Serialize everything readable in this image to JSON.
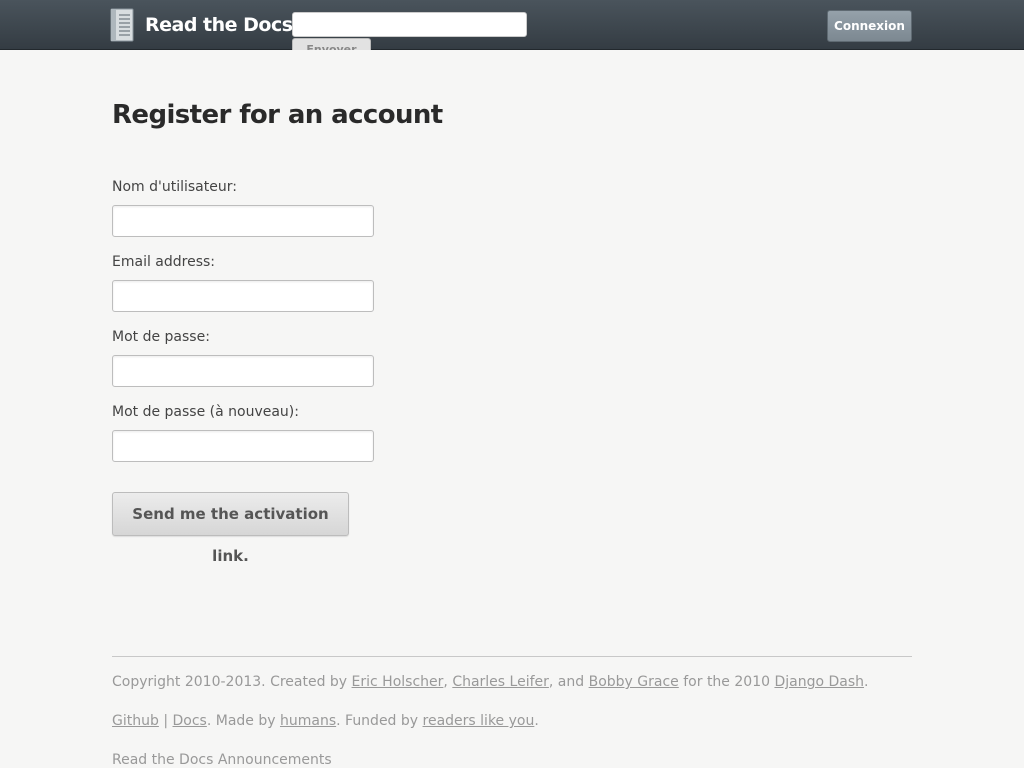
{
  "header": {
    "brand": "Read the Docs",
    "search_placeholder": "",
    "search_button": "Envoyer",
    "login_button": "Connexion"
  },
  "main": {
    "title": "Register for an account",
    "fields": [
      {
        "label": "Nom d'utilisateur:",
        "value": ""
      },
      {
        "label": "Email address:",
        "value": ""
      },
      {
        "label": "Mot de passe:",
        "value": ""
      },
      {
        "label": "Mot de passe (à nouveau):",
        "value": ""
      }
    ],
    "submit_button": "Send me the activation link."
  },
  "footer": {
    "copyright": {
      "prefix": "Copyright 2010-2013. Created by ",
      "author1": "Eric Holscher",
      "sep1": ", ",
      "author2": "Charles Leifer",
      "sep2": ", and ",
      "author3": "Bobby Grace",
      "mid": " for the 2010 ",
      "event": "Django Dash",
      "end": "."
    },
    "links": {
      "github": "Github",
      "pipe": " | ",
      "docs": "Docs",
      "made_by": ". Made by ",
      "humans": "humans",
      "funded_by": ". Funded by ",
      "readers": "readers like you",
      "end": "."
    },
    "announcements": "Read the Docs Announcements"
  }
}
